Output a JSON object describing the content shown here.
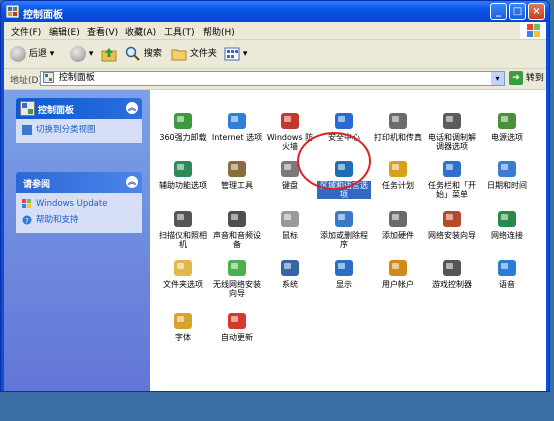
{
  "window": {
    "title": "控制面板"
  },
  "menubar": [
    "文件(F)",
    "编辑(E)",
    "查看(V)",
    "收藏(A)",
    "工具(T)",
    "帮助(H)"
  ],
  "toolbar": {
    "back": "后退",
    "search": "搜索",
    "folders": "文件夹"
  },
  "address": {
    "label": "地址(D)",
    "value": "控制面板",
    "go": "转到"
  },
  "sidebar": {
    "panel1": {
      "title": "控制面板",
      "link": "切换到分类视图"
    },
    "panel2": {
      "title": "请参阅",
      "links": [
        "Windows Update",
        "帮助和支持"
      ]
    }
  },
  "items": [
    {
      "label": "360强力卸载",
      "icon": "360-uninstall-icon",
      "color": "#3f9a3f"
    },
    {
      "label": "Internet 选项",
      "icon": "internet-options-icon",
      "color": "#2f7fd8"
    },
    {
      "label": "Windows 防火墙",
      "icon": "firewall-icon",
      "color": "#c0392b"
    },
    {
      "label": "安全中心",
      "icon": "security-center-icon",
      "color": "#2a6ad4"
    },
    {
      "label": "打印机和传真",
      "icon": "printer-icon",
      "color": "#6c6c6c"
    },
    {
      "label": "电话和调制解调器选项",
      "icon": "phone-modem-icon",
      "color": "#5b5b5b"
    },
    {
      "label": "电源选项",
      "icon": "power-options-icon",
      "color": "#4a8f3a"
    },
    {
      "label": "辅助功能选项",
      "icon": "accessibility-icon",
      "color": "#2e8b57"
    },
    {
      "label": "管理工具",
      "icon": "admin-tools-icon",
      "color": "#8a6d3b"
    },
    {
      "label": "键盘",
      "icon": "keyboard-icon",
      "color": "#7a7a7a"
    },
    {
      "label": "区域和语言选项",
      "icon": "region-language-icon",
      "color": "#1c6fb7"
    },
    {
      "label": "任务计划",
      "icon": "scheduled-tasks-icon",
      "color": "#d6a21a"
    },
    {
      "label": "任务栏和「开始」菜单",
      "icon": "taskbar-start-icon",
      "color": "#2f6fd0"
    },
    {
      "label": "日期和时间",
      "icon": "date-time-icon",
      "color": "#3b7bd3"
    },
    {
      "label": "扫描仪和照相机",
      "icon": "scanner-camera-icon",
      "color": "#555555"
    },
    {
      "label": "声音和音频设备",
      "icon": "sound-icon",
      "color": "#4f4f4f"
    },
    {
      "label": "鼠标",
      "icon": "mouse-icon",
      "color": "#9a9a9a"
    },
    {
      "label": "添加或删除程序",
      "icon": "add-remove-programs-icon",
      "color": "#3c78c8"
    },
    {
      "label": "添加硬件",
      "icon": "add-hardware-icon",
      "color": "#6a6a6a"
    },
    {
      "label": "网络安装向导",
      "icon": "network-setup-icon",
      "color": "#b84a2a"
    },
    {
      "label": "网络连接",
      "icon": "network-connections-icon",
      "color": "#2a8a4a"
    },
    {
      "label": "文件夹选项",
      "icon": "folder-options-icon",
      "color": "#e1b84a"
    },
    {
      "label": "无线网络安装向导",
      "icon": "wireless-setup-icon",
      "color": "#4caf50"
    },
    {
      "label": "系统",
      "icon": "system-icon",
      "color": "#3465a4"
    },
    {
      "label": "显示",
      "icon": "display-icon",
      "color": "#2c6ec6"
    },
    {
      "label": "用户帐户",
      "icon": "user-accounts-icon",
      "color": "#d08a1a"
    },
    {
      "label": "游戏控制器",
      "icon": "game-controller-icon",
      "color": "#555555"
    },
    {
      "label": "语音",
      "icon": "speech-icon",
      "color": "#2b7bd6"
    },
    {
      "label": "字体",
      "icon": "fonts-icon",
      "color": "#d4a52a"
    },
    {
      "label": "自动更新",
      "icon": "automatic-updates-icon",
      "color": "#d33a2a"
    }
  ]
}
